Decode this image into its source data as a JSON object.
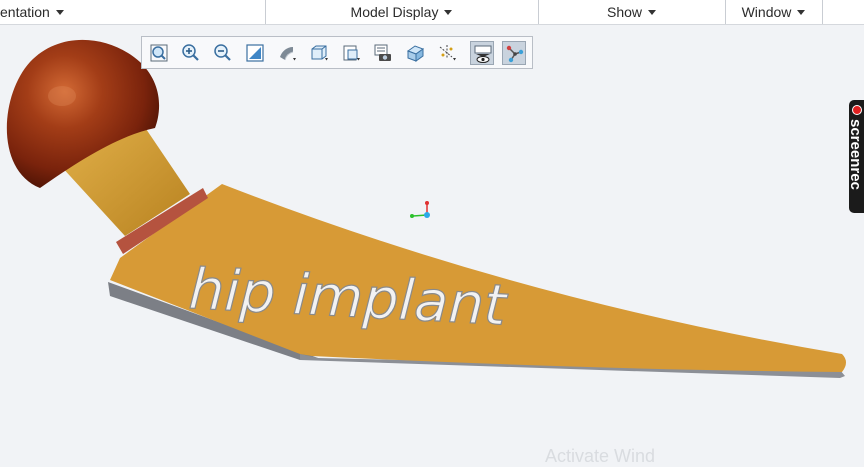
{
  "menu": {
    "items": [
      {
        "label": "entation"
      },
      {
        "label": "Model Display"
      },
      {
        "label": "Show"
      },
      {
        "label": "Window"
      }
    ]
  },
  "toolbar": {
    "icons": [
      "refit-icon",
      "zoom-in-icon",
      "zoom-out-icon",
      "repaint-icon",
      "display-style-icon",
      "saved-orientations-icon",
      "named-views-icon",
      "view-manager-icon",
      "perspective-view-icon",
      "datum-display-icon",
      "annotation-display-icon",
      "spin-center-icon"
    ],
    "active": [
      "annotation-display-icon",
      "spin-center-icon"
    ]
  },
  "model": {
    "engraving": "hip  implant",
    "colors": {
      "stem": "#d79a36",
      "neck": "#c9972c",
      "collar": "#b5533f",
      "head": "#8a2a12",
      "shadow": "#8c8f96"
    }
  },
  "overlay": {
    "screenrec_label": "screenrec",
    "watermark": "Activate Wind"
  },
  "colors": {
    "ribbon_bg": "#ffffff",
    "viewport_bg": "#f1f3f6",
    "toolbar_bg": "#f8f9fb",
    "active_button": "#c9d3de"
  }
}
